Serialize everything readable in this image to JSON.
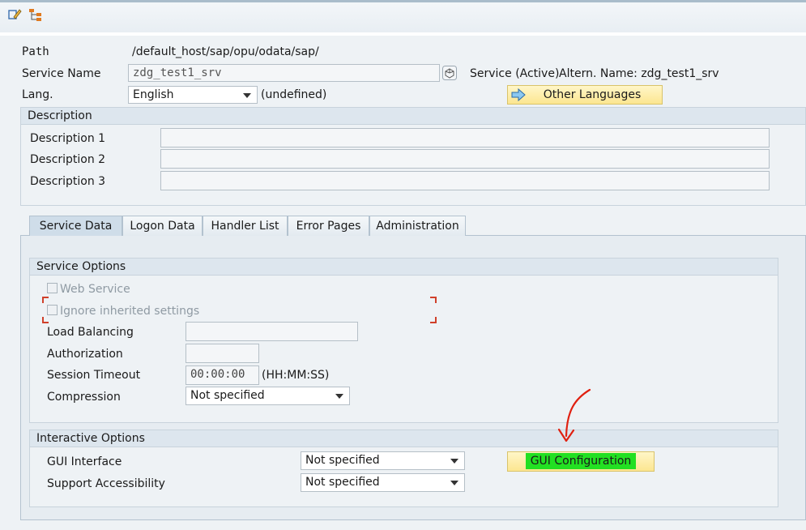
{
  "toolbar": {
    "icons": [
      "display-change-icon",
      "hierarchy-icon"
    ]
  },
  "header": {
    "path_label": "Path",
    "path_value": "/default_host/sap/opu/odata/sap/",
    "service_name_label": "Service Name",
    "service_name_value": "zdg_test1_srv",
    "service_status": "Service (Active)",
    "altern_name": "Altern. Name: zdg_test1_srv",
    "lang_label": "Lang.",
    "lang_value": "English",
    "lang_undefined": "(undefined)",
    "other_languages_label": "Other Languages"
  },
  "description": {
    "title": "Description",
    "rows": [
      {
        "label": "Description 1",
        "value": ""
      },
      {
        "label": "Description 2",
        "value": ""
      },
      {
        "label": "Description 3",
        "value": ""
      }
    ]
  },
  "tabs": [
    {
      "label": "Service Data",
      "active": true
    },
    {
      "label": "Logon Data",
      "active": false
    },
    {
      "label": "Handler List",
      "active": false
    },
    {
      "label": "Error Pages",
      "active": false
    },
    {
      "label": "Administration",
      "active": false
    }
  ],
  "service_options": {
    "title": "Service Options",
    "web_service_label": "Web Service",
    "web_service_checked": false,
    "ignore_inherited_label": "Ignore inherited settings",
    "ignore_inherited_checked": false,
    "load_balancing_label": "Load Balancing",
    "load_balancing_value": "",
    "authorization_label": "Authorization",
    "authorization_value": "",
    "session_timeout_label": "Session Timeout",
    "session_timeout_value": "00:00:00",
    "session_timeout_format": "(HH:MM:SS)",
    "compression_label": "Compression",
    "compression_value": "Not specified"
  },
  "interactive_options": {
    "title": "Interactive Options",
    "gui_interface_label": "GUI Interface",
    "gui_interface_value": "Not specified",
    "support_accessibility_label": "Support Accessibility",
    "support_accessibility_value": "Not specified",
    "gui_configuration_label": "GUI Configuration"
  },
  "colors": {
    "highlight": "#22e022",
    "annotation_arrow": "#e02010",
    "button_yellow": "#fce690"
  }
}
